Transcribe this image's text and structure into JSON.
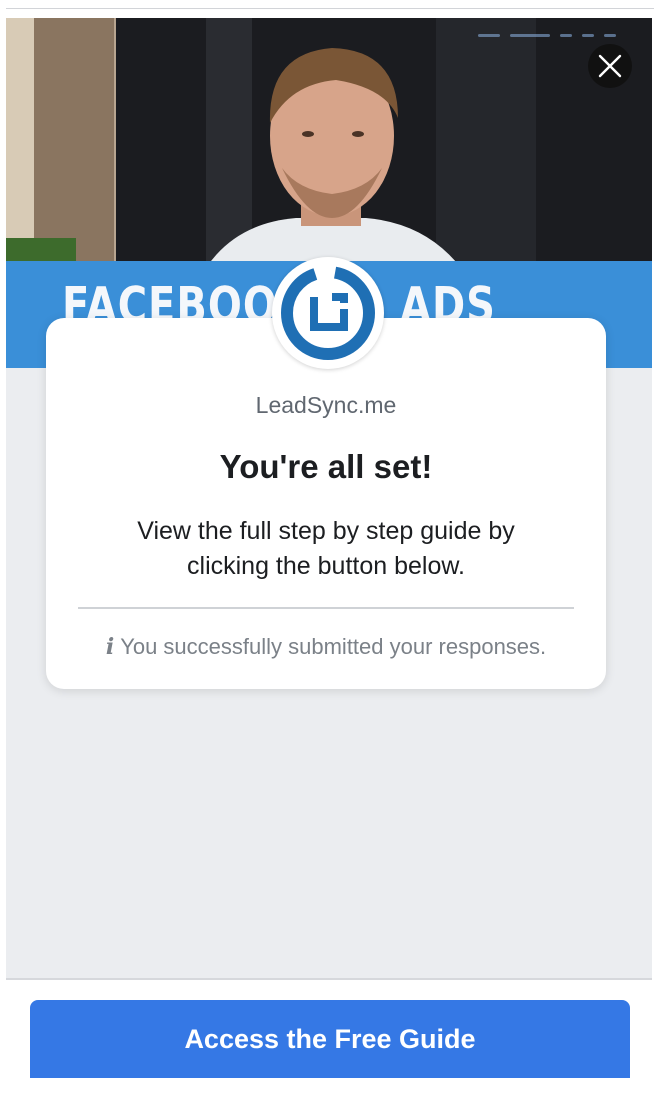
{
  "video": {
    "banner_left": "FACEBOOK",
    "banner_right": "ADS GUIDE"
  },
  "close": {
    "icon": "close-icon"
  },
  "card": {
    "brand_name": "LeadSync.me",
    "heading": "You're all set!",
    "body": "View the full step by step guide by clicking the button below.",
    "notice_icon": "i",
    "notice": "You successfully submitted your responses."
  },
  "cta": {
    "label": "Access the Free Guide"
  },
  "colors": {
    "accent": "#3578e5",
    "banner": "#3a8fd8",
    "logo": "#1f6fb4"
  }
}
